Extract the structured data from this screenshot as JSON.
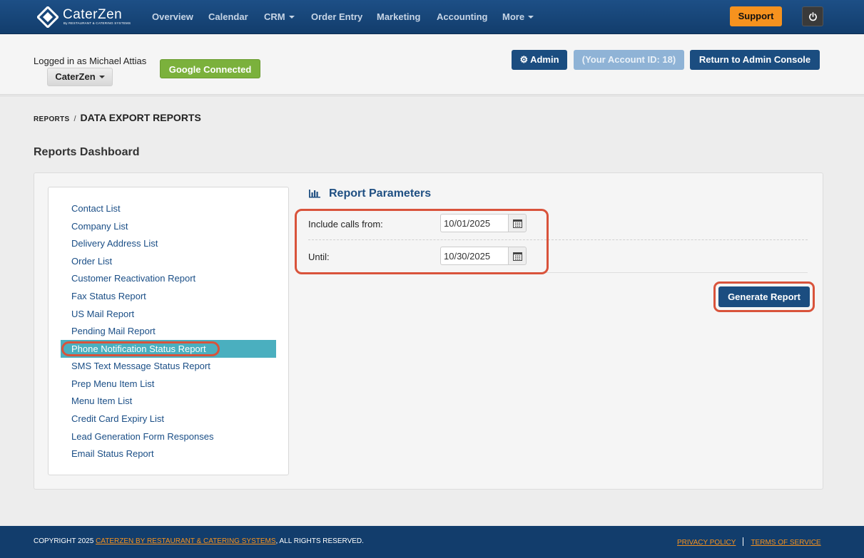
{
  "brand": {
    "name": "CaterZen",
    "tagline": "By RESTAURANT & CATERING SYSTEMS"
  },
  "nav": {
    "items": [
      {
        "label": "Overview"
      },
      {
        "label": "Calendar"
      },
      {
        "label": "CRM"
      },
      {
        "label": "Order Entry"
      },
      {
        "label": "Marketing"
      },
      {
        "label": "Accounting"
      },
      {
        "label": "More"
      }
    ],
    "support_label": "Support"
  },
  "subheader": {
    "logged_in_text": "Logged in as Michael Attias",
    "account_name": "CaterZen",
    "google_status": "Google Connected",
    "admin_label": "Admin",
    "account_id_label": "(Your Account ID: 18)",
    "return_label": "Return to Admin Console"
  },
  "breadcrumb": {
    "parent": "REPORTS",
    "separator": "/",
    "current": "DATA EXPORT REPORTS"
  },
  "dashboard_title": "Reports Dashboard",
  "reports": [
    {
      "label": "Contact List",
      "active": false
    },
    {
      "label": "Company List",
      "active": false
    },
    {
      "label": "Delivery Address List",
      "active": false
    },
    {
      "label": "Order List",
      "active": false
    },
    {
      "label": "Customer Reactivation Report",
      "active": false
    },
    {
      "label": "Fax Status Report",
      "active": false
    },
    {
      "label": "US Mail Report",
      "active": false
    },
    {
      "label": "Pending Mail Report",
      "active": false
    },
    {
      "label": "Phone Notification Status Report",
      "active": true
    },
    {
      "label": "SMS Text Message Status Report",
      "active": false
    },
    {
      "label": "Prep Menu Item List",
      "active": false
    },
    {
      "label": "Menu Item List",
      "active": false
    },
    {
      "label": "Credit Card Expiry List",
      "active": false
    },
    {
      "label": "Lead Generation Form Responses",
      "active": false
    },
    {
      "label": "Email Status Report",
      "active": false
    }
  ],
  "params": {
    "title": "Report Parameters",
    "from_label": "Include calls from:",
    "from_value": "10/01/2025",
    "until_label": "Until:",
    "until_value": "10/30/2025",
    "generate_label": "Generate Report"
  },
  "footer": {
    "copyright_prefix": "COPYRIGHT 2025 ",
    "company_link": "CATERZEN BY RESTAURANT & CATERING SYSTEMS",
    "copyright_suffix": ", ALL RIGHTS RESERVED.",
    "privacy": "PRIVACY POLICY",
    "terms": "TERMS OF SERVICE"
  },
  "colors": {
    "nav_bg": "#1d4f86",
    "accent_orange": "#f6921e",
    "primary_button": "#1b4d80",
    "active_item": "#4aafbf",
    "highlight_ring": "#d9533b",
    "google_green": "#7bb13c"
  }
}
